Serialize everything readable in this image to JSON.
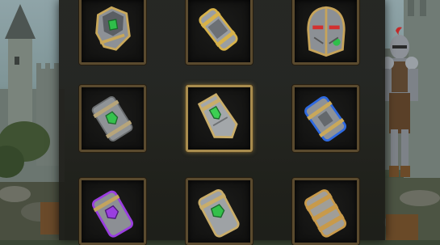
{
  "inventory": {
    "slots": [
      {
        "item": "emerald-gem-chestplate-icon",
        "gem_color": "#2fbf4a",
        "selected": false
      },
      {
        "item": "gold-trim-bracer-icon",
        "gem_color": "#d7b24a",
        "selected": false
      },
      {
        "item": "red-eyed-knight-helmet-icon",
        "gem_color": "#d23030",
        "selected": false
      },
      {
        "item": "green-gem-silver-bracer-icon",
        "gem_color": "#35c24d",
        "selected": false
      },
      {
        "item": "green-gem-gauntlet-bracer-icon",
        "gem_color": "#3ccf52",
        "selected": true
      },
      {
        "item": "blue-glow-bracer-icon",
        "gem_color": "#2f6ae0",
        "selected": false
      },
      {
        "item": "purple-gem-bracer-icon",
        "gem_color": "#9a3ee0",
        "selected": false
      },
      {
        "item": "green-gem-gold-bracer-icon",
        "gem_color": "#33c04a",
        "selected": false
      },
      {
        "item": "bronze-trim-bracer-icon",
        "gem_color": "#c89a4a",
        "selected": false
      }
    ]
  },
  "colors": {
    "slot_border": "#5a4a2e",
    "selected_border": "#a88c4e",
    "panel_bg": "#1e1e1a"
  }
}
